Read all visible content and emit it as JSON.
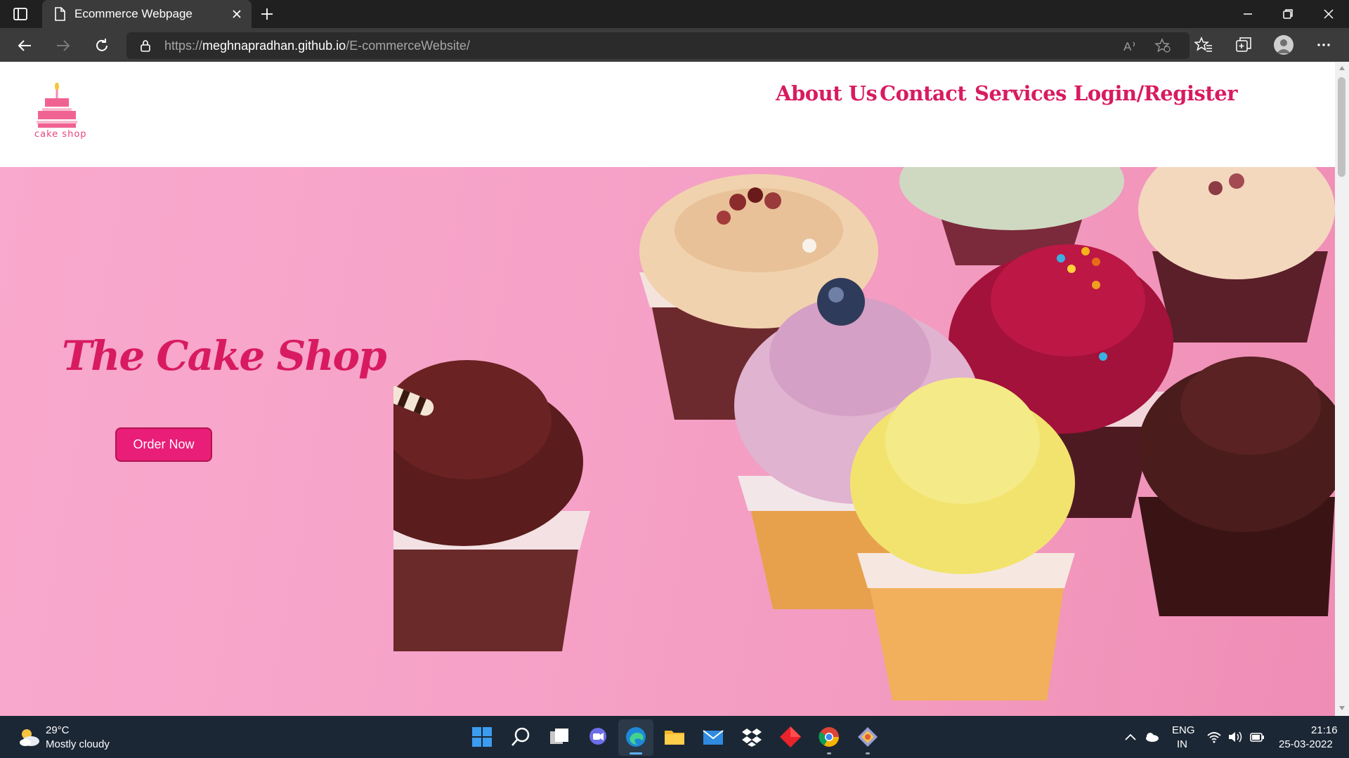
{
  "browser": {
    "tab_title": "Ecommerce Webpage",
    "url_prefix": "https://",
    "url_host": "meghnapradhan.github.io",
    "url_path": "/E-commerceWebsite/"
  },
  "site": {
    "logo_text": "cake shop",
    "nav": [
      "About Us",
      "Contact",
      "Services",
      "Login/Register"
    ],
    "hero_title": "The Cake Shop",
    "order_button": "Order Now",
    "accent_color": "#d81b60",
    "button_color": "#e91e78",
    "hero_bg": "#f6a2c8"
  },
  "taskbar": {
    "temperature": "29°C",
    "weather": "Mostly cloudy",
    "language": "ENG",
    "region": "IN",
    "time": "21:16",
    "date": "25-03-2022",
    "icons": [
      "start-icon",
      "search-icon",
      "task-view-icon",
      "chat-icon",
      "edge-icon",
      "file-explorer-icon",
      "mail-icon",
      "dropbox-icon",
      "app-red-icon",
      "chrome-icon",
      "git-icon"
    ]
  }
}
